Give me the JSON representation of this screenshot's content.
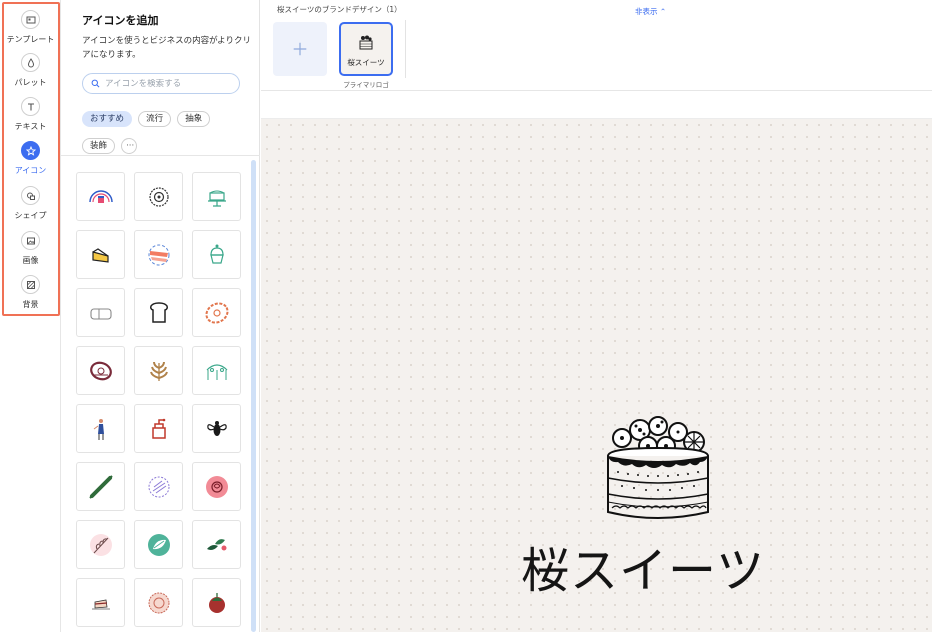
{
  "rail": {
    "items": [
      {
        "label": "テンプレート",
        "icon": "template-icon"
      },
      {
        "label": "パレット",
        "icon": "palette-drop-icon"
      },
      {
        "label": "テキスト",
        "icon": "text-icon"
      },
      {
        "label": "アイコン",
        "icon": "star-icon",
        "active": true
      },
      {
        "label": "シェイプ",
        "icon": "shape-icon"
      },
      {
        "label": "画像",
        "icon": "image-icon"
      },
      {
        "label": "背景",
        "icon": "background-icon"
      }
    ],
    "highlight_color": "#f07155"
  },
  "panel": {
    "title": "アイコンを追加",
    "description": "アイコンを使うとビジネスの内容がよりクリアになります。",
    "search_placeholder": "アイコンを検索する",
    "chips": [
      "おすすめ",
      "流行",
      "抽象",
      "装飾"
    ],
    "active_chip": "おすすめ",
    "icons": [
      "rainbow-cupcake-icon",
      "donut-circle-icon",
      "cake-stand-icon",
      "cake-slice-icon",
      "painted-cake-icon",
      "cupcake-outline-icon",
      "bread-loaf-icon",
      "toast-slice-icon",
      "orange-donut-icon",
      "donut-badge-icon",
      "wheat-icon",
      "bakery-arch-icon",
      "woman-figure-icon",
      "coffee-grinder-icon",
      "bee-icon",
      "rolling-pin-icon",
      "purple-badge-icon",
      "pink-rose-icon",
      "leaf-sketch-icon",
      "teal-leaf-icon",
      "green-leaves-icon",
      "cake-plate-icon",
      "pink-circle-icon",
      "red-fruit-icon"
    ]
  },
  "topbar": {
    "title": "桜スイーツのブランドデザイン（1）",
    "hide_label": "非表示",
    "add_icon": "plus-icon",
    "logo_thumb_name": "桜スイーツ",
    "logo_thumb_caption": "プライマリロゴ"
  },
  "canvas": {
    "brand_name": "桜スイーツ",
    "logo_icon": "cake-illustration-icon",
    "background": "#f4f1ee"
  },
  "colors": {
    "accent": "#3c6df0",
    "chip_active_bg": "#d8e4fb"
  }
}
